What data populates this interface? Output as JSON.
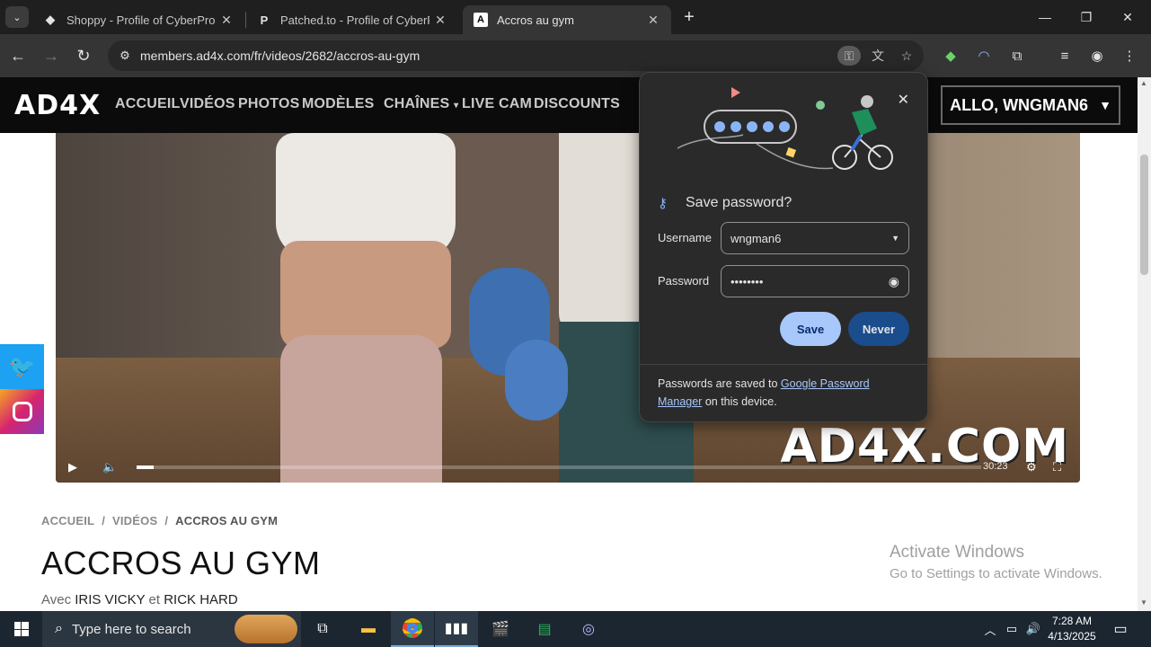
{
  "browser": {
    "tabs": [
      {
        "title": "Shoppy - Profile of CyberProMa",
        "favicon": "S"
      },
      {
        "title": "Patched.to - Profile of CyberPro",
        "favicon": "P"
      },
      {
        "title": "Accros au gym",
        "favicon": "A"
      }
    ],
    "url": "members.ad4x.com/fr/videos/2682/accros-au-gym"
  },
  "site": {
    "logo": "AD4X",
    "nav": [
      "ACCUEIL",
      "VIDÉOS",
      "PHOTOS",
      "MODÈLES",
      "CHAÎNES",
      "LIVE CAM",
      "DISCOUNTS"
    ],
    "user_button": "ALLO, WNGMAN6",
    "video": {
      "watermark": "AD4X.COM",
      "time": "30:23",
      "progress": 0.02
    },
    "breadcrumb": [
      "ACCUEIL",
      "VIDÉOS",
      "ACCROS AU GYM"
    ],
    "title": "ACCROS AU GYM",
    "avec_prefix": "Avec",
    "model1": "IRIS VICKY",
    "conj": "et",
    "model2": "RICK HARD"
  },
  "password_popup": {
    "heading": "Save password?",
    "username_label": "Username",
    "username_value": "wngman6",
    "password_label": "Password",
    "password_value": "••••••••",
    "save_label": "Save",
    "never_label": "Never",
    "footer_text": "Passwords are saved to",
    "footer_link": "Google Password Manager",
    "footer_tail": "on this device."
  },
  "windows": {
    "activate_title": "Activate Windows",
    "activate_sub": "Go to Settings to activate Windows.",
    "search_placeholder": "Type here to search",
    "time": "7:28 AM",
    "date": "4/13/2025"
  },
  "colors": {
    "accent_blue": "#a8c7fa",
    "never_blue": "#1b4c8c",
    "twitter": "#1da1f2",
    "instagram": "#d6246f"
  }
}
